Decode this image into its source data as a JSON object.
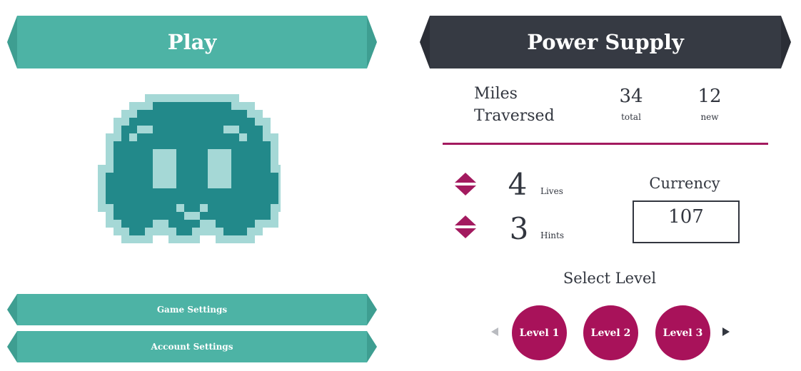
{
  "play": {
    "label": "Play"
  },
  "title": "Power Supply",
  "menu": {
    "game_settings": "Game Settings",
    "account_settings": "Account Settings"
  },
  "character": {
    "icon": "pixel-ghost"
  },
  "stats": {
    "miles_label_line1": "Miles",
    "miles_label_line2": "Traversed",
    "miles_total": "34",
    "miles_total_label": "total",
    "miles_new": "12",
    "miles_new_label": "new",
    "lives": "4",
    "lives_label": "Lives",
    "hints": "3",
    "hints_label": "Hints"
  },
  "currency": {
    "label": "Currency",
    "value": "107"
  },
  "levels": {
    "title": "Select Level",
    "items": [
      "Level 1",
      "Level 2",
      "Level 3"
    ]
  },
  "colors": {
    "teal": "#4db3a5",
    "dark": "#363a43",
    "magenta": "#a8125a",
    "ghost_body": "#22898a",
    "ghost_light": "#a5d8d6"
  }
}
